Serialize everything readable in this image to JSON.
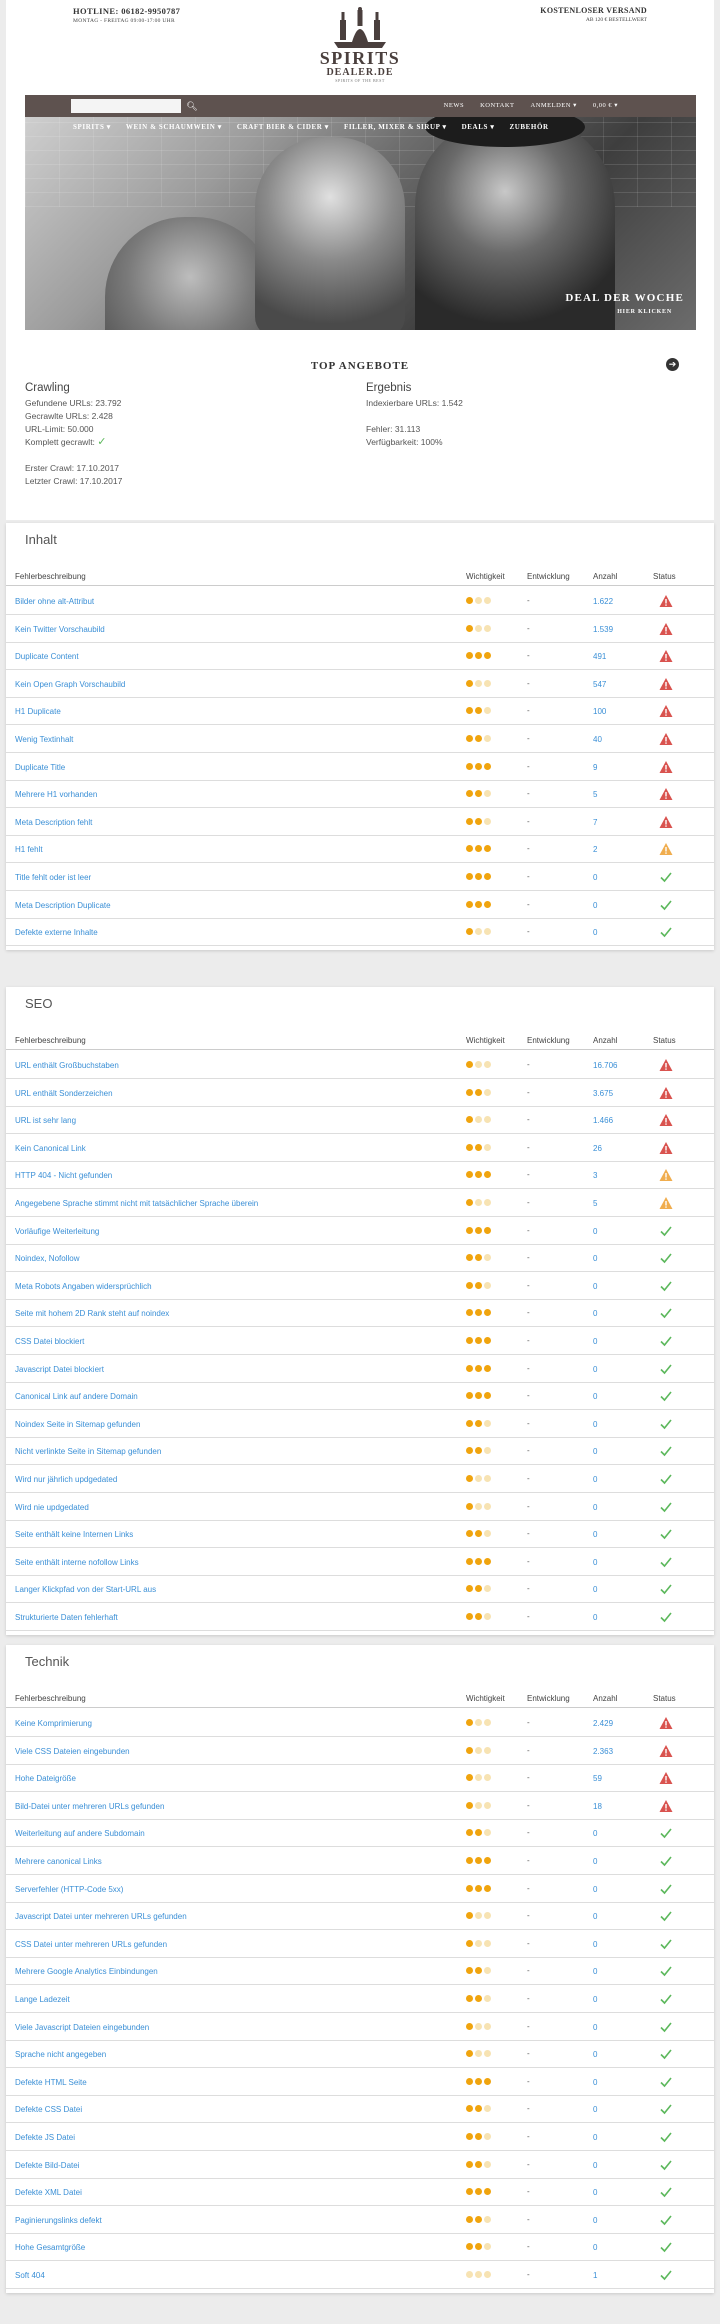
{
  "shop": {
    "hotline": "HOTLINE: 06182-9950787",
    "hours": "MONTAG - FREITAG 09:00-17:00 UHR",
    "shipping": "KOSTENLOSER VERSAND",
    "shipping_sub": "AB 120 € BESTELLWERT",
    "logo_line1": "SPIRITS",
    "logo_line2": "DEALER.DE",
    "logo_tagline": "SPIRITS OF THE BEST",
    "search_placeholder": "",
    "topnav": [
      "NEWS",
      "KONTAKT",
      "ANMELDEN ▾",
      "0,00 € ▾"
    ],
    "categories": [
      "SPIRITS ▾",
      "WEIN & SCHAUMWEIN ▾",
      "CRAFT BIER & CIDER ▾",
      "FILLER, MIXER & SIRUP ▾",
      "DEALS ▾",
      "ZUBEHÖR"
    ],
    "deal_title": "DEAL DER WOCHE",
    "deal_link": "HIER KLICKEN",
    "top_offers": "TOP ANGEBOTE"
  },
  "crawling": {
    "title": "Crawling",
    "found": "Gefundene URLs: 23.792",
    "crawled": "Gecrawlte URLs: 2.428",
    "limit": "URL-Limit: 50.000",
    "complete": "Komplett gecrawlt:",
    "first": "Erster Crawl: 17.10.2017",
    "last": "Letzter Crawl: 17.10.2017"
  },
  "result": {
    "title": "Ergebnis",
    "indexable": "Indexierbare URLs: 1.542",
    "errors": "Fehler: 31.113",
    "availability": "Verfügbarkeit: 100%"
  },
  "table_headers": {
    "name": "Fehlerbeschreibung",
    "importance": "Wichtigkeit",
    "development": "Entwicklung",
    "count": "Anzahl",
    "status": "Status"
  },
  "colors": {
    "link": "#3a8fd6",
    "dot": "#f0a40e",
    "error": "#d9534f",
    "warning": "#f0ad4e",
    "ok": "#5cb85c"
  },
  "sections": [
    {
      "title": "Inhalt",
      "rows": [
        {
          "name": "Bilder ohne alt-Attribut",
          "importance": 1,
          "trend": "-",
          "count": "1.622",
          "status": "error"
        },
        {
          "name": "Kein Twitter Vorschaubild",
          "importance": 1,
          "trend": "-",
          "count": "1.539",
          "status": "error"
        },
        {
          "name": "Duplicate Content",
          "importance": 3,
          "trend": "-",
          "count": "491",
          "status": "error"
        },
        {
          "name": "Kein Open Graph Vorschaubild",
          "importance": 1,
          "trend": "-",
          "count": "547",
          "status": "error"
        },
        {
          "name": "H1 Duplicate",
          "importance": 2,
          "trend": "-",
          "count": "100",
          "status": "error"
        },
        {
          "name": "Wenig Textinhalt",
          "importance": 2,
          "trend": "-",
          "count": "40",
          "status": "error"
        },
        {
          "name": "Duplicate Title",
          "importance": 3,
          "trend": "-",
          "count": "9",
          "status": "error"
        },
        {
          "name": "Mehrere H1 vorhanden",
          "importance": 2,
          "trend": "-",
          "count": "5",
          "status": "error"
        },
        {
          "name": "Meta Description fehlt",
          "importance": 2,
          "trend": "-",
          "count": "7",
          "status": "error"
        },
        {
          "name": "H1 fehlt",
          "importance": 3,
          "trend": "-",
          "count": "2",
          "status": "warning"
        },
        {
          "name": "Title fehlt oder ist leer",
          "importance": 3,
          "trend": "-",
          "count": "0",
          "status": "ok"
        },
        {
          "name": "Meta Description Duplicate",
          "importance": 3,
          "trend": "-",
          "count": "0",
          "status": "ok"
        },
        {
          "name": "Defekte externe Inhalte",
          "importance": 1,
          "trend": "-",
          "count": "0",
          "status": "ok"
        }
      ]
    },
    {
      "title": "SEO",
      "rows": [
        {
          "name": "URL enthält Großbuchstaben",
          "importance": 1,
          "trend": "-",
          "count": "16.706",
          "status": "error"
        },
        {
          "name": "URL enthält Sonderzeichen",
          "importance": 2,
          "trend": "-",
          "count": "3.675",
          "status": "error"
        },
        {
          "name": "URL ist sehr lang",
          "importance": 1,
          "trend": "-",
          "count": "1.466",
          "status": "error"
        },
        {
          "name": "Kein Canonical Link",
          "importance": 2,
          "trend": "-",
          "count": "26",
          "status": "error"
        },
        {
          "name": "HTTP 404 - Nicht gefunden",
          "importance": 3,
          "trend": "-",
          "count": "3",
          "status": "warning"
        },
        {
          "name": "Angegebene Sprache stimmt nicht mit tatsächlicher Sprache überein",
          "importance": 1,
          "trend": "-",
          "count": "5",
          "status": "warning"
        },
        {
          "name": "Vorläufige Weiterleitung",
          "importance": 3,
          "trend": "-",
          "count": "0",
          "status": "ok"
        },
        {
          "name": "Noindex, Nofollow",
          "importance": 2,
          "trend": "-",
          "count": "0",
          "status": "ok"
        },
        {
          "name": "Meta Robots Angaben widersprüchlich",
          "importance": 2,
          "trend": "-",
          "count": "0",
          "status": "ok"
        },
        {
          "name": "Seite mit hohem 2D Rank steht auf noindex",
          "importance": 3,
          "trend": "-",
          "count": "0",
          "status": "ok"
        },
        {
          "name": "CSS Datei blockiert",
          "importance": 3,
          "trend": "-",
          "count": "0",
          "status": "ok"
        },
        {
          "name": "Javascript Datei blockiert",
          "importance": 3,
          "trend": "-",
          "count": "0",
          "status": "ok"
        },
        {
          "name": "Canonical Link auf andere Domain",
          "importance": 3,
          "trend": "-",
          "count": "0",
          "status": "ok"
        },
        {
          "name": "Noindex Seite in Sitemap gefunden",
          "importance": 2,
          "trend": "-",
          "count": "0",
          "status": "ok"
        },
        {
          "name": "Nicht verlinkte Seite in Sitemap gefunden",
          "importance": 2,
          "trend": "-",
          "count": "0",
          "status": "ok"
        },
        {
          "name": "Wird nur jährlich updgedated",
          "importance": 1,
          "trend": "-",
          "count": "0",
          "status": "ok"
        },
        {
          "name": "Wird nie updgedated",
          "importance": 1,
          "trend": "-",
          "count": "0",
          "status": "ok"
        },
        {
          "name": "Seite enthält keine Internen Links",
          "importance": 2,
          "trend": "-",
          "count": "0",
          "status": "ok"
        },
        {
          "name": "Seite enthält interne nofollow Links",
          "importance": 3,
          "trend": "-",
          "count": "0",
          "status": "ok"
        },
        {
          "name": "Langer Klickpfad von der Start-URL aus",
          "importance": 2,
          "trend": "-",
          "count": "0",
          "status": "ok"
        },
        {
          "name": "Strukturierte Daten fehlerhaft",
          "importance": 2,
          "trend": "-",
          "count": "0",
          "status": "ok"
        }
      ]
    },
    {
      "title": "Technik",
      "rows": [
        {
          "name": "Keine Komprimierung",
          "importance": 1,
          "trend": "-",
          "count": "2.429",
          "status": "error"
        },
        {
          "name": "Viele CSS Dateien eingebunden",
          "importance": 1,
          "trend": "-",
          "count": "2.363",
          "status": "error"
        },
        {
          "name": "Hohe Dateigröße",
          "importance": 1,
          "trend": "-",
          "count": "59",
          "status": "error"
        },
        {
          "name": "Bild-Datei unter mehreren URLs gefunden",
          "importance": 1,
          "trend": "-",
          "count": "18",
          "status": "error"
        },
        {
          "name": "Weiterleitung auf andere Subdomain",
          "importance": 2,
          "trend": "-",
          "count": "0",
          "status": "ok"
        },
        {
          "name": "Mehrere canonical Links",
          "importance": 3,
          "trend": "-",
          "count": "0",
          "status": "ok"
        },
        {
          "name": "Serverfehler (HTTP-Code 5xx)",
          "importance": 3,
          "trend": "-",
          "count": "0",
          "status": "ok"
        },
        {
          "name": "Javascript Datei unter mehreren URLs gefunden",
          "importance": 1,
          "trend": "-",
          "count": "0",
          "status": "ok"
        },
        {
          "name": "CSS Datei unter mehreren URLs gefunden",
          "importance": 1,
          "trend": "-",
          "count": "0",
          "status": "ok"
        },
        {
          "name": "Mehrere Google Analytics Einbindungen",
          "importance": 2,
          "trend": "-",
          "count": "0",
          "status": "ok"
        },
        {
          "name": "Lange Ladezeit",
          "importance": 2,
          "trend": "-",
          "count": "0",
          "status": "ok"
        },
        {
          "name": "Viele Javascript Dateien eingebunden",
          "importance": 1,
          "trend": "-",
          "count": "0",
          "status": "ok"
        },
        {
          "name": "Sprache nicht angegeben",
          "importance": 1,
          "trend": "-",
          "count": "0",
          "status": "ok"
        },
        {
          "name": "Defekte HTML Seite",
          "importance": 3,
          "trend": "-",
          "count": "0",
          "status": "ok"
        },
        {
          "name": "Defekte CSS Datei",
          "importance": 2,
          "trend": "-",
          "count": "0",
          "status": "ok"
        },
        {
          "name": "Defekte JS Datei",
          "importance": 2,
          "trend": "-",
          "count": "0",
          "status": "ok"
        },
        {
          "name": "Defekte Bild-Datei",
          "importance": 2,
          "trend": "-",
          "count": "0",
          "status": "ok"
        },
        {
          "name": "Defekte XML Datei",
          "importance": 3,
          "trend": "-",
          "count": "0",
          "status": "ok"
        },
        {
          "name": "Paginierungslinks defekt",
          "importance": 2,
          "trend": "-",
          "count": "0",
          "status": "ok"
        },
        {
          "name": "Hohe Gesamtgröße",
          "importance": 2,
          "trend": "-",
          "count": "0",
          "status": "ok"
        },
        {
          "name": "Soft 404",
          "importance": 0,
          "trend": "-",
          "count": "1",
          "status": "ok"
        }
      ]
    }
  ]
}
